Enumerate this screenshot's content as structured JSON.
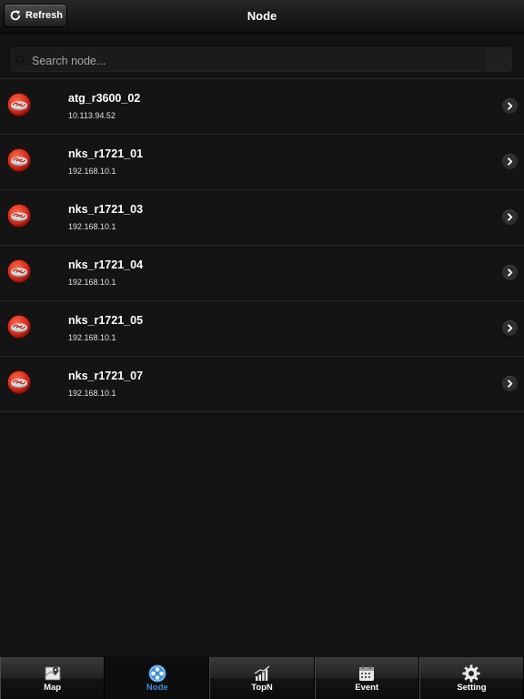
{
  "header": {
    "title": "Node",
    "refresh_label": "Refresh"
  },
  "search": {
    "placeholder": "Search node...",
    "value": ""
  },
  "nodes": [
    {
      "name": "atg_r3600_02",
      "ip": "10.113.94.52"
    },
    {
      "name": "nks_r1721_01",
      "ip": "192.168.10.1"
    },
    {
      "name": "nks_r1721_03",
      "ip": "192.168.10.1"
    },
    {
      "name": "nks_r1721_04",
      "ip": "192.168.10.1"
    },
    {
      "name": "nks_r1721_05",
      "ip": "192.168.10.1"
    },
    {
      "name": "nks_r1721_07",
      "ip": "192.168.10.1"
    }
  ],
  "tabs": [
    {
      "label": "Map",
      "icon": "map-icon",
      "active": false
    },
    {
      "label": "Node",
      "icon": "node-icon",
      "active": true
    },
    {
      "label": "TopN",
      "icon": "topn-chart-icon",
      "active": false
    },
    {
      "label": "Event",
      "icon": "event-calendar-icon",
      "active": false
    },
    {
      "label": "Setting",
      "icon": "gear-icon",
      "active": false
    }
  ],
  "colors": {
    "active_tab": "#3d8fd8",
    "node_icon": "#d42a1a",
    "background": "#121212"
  }
}
